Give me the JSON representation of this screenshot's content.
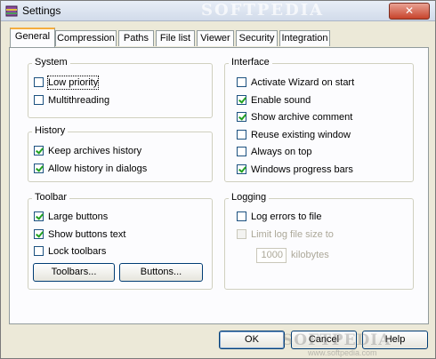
{
  "window": {
    "title": "Settings",
    "watermark": "SOFTPEDIA",
    "close_glyph": "✕"
  },
  "tabs": [
    {
      "label": "General",
      "active": true
    },
    {
      "label": "Compression"
    },
    {
      "label": "Paths"
    },
    {
      "label": "File list"
    },
    {
      "label": "Viewer"
    },
    {
      "label": "Security"
    },
    {
      "label": "Integration"
    }
  ],
  "groups": {
    "system": {
      "title": "System",
      "items": [
        {
          "label": "Low priority",
          "checked": false
        },
        {
          "label": "Multithreading",
          "checked": false
        }
      ]
    },
    "history": {
      "title": "History",
      "items": [
        {
          "label": "Keep archives history",
          "checked": true
        },
        {
          "label": "Allow history in dialogs",
          "checked": true
        }
      ]
    },
    "toolbar": {
      "title": "Toolbar",
      "items": [
        {
          "label": "Large buttons",
          "checked": true
        },
        {
          "label": "Show buttons text",
          "checked": true
        },
        {
          "label": "Lock toolbars",
          "checked": false
        }
      ],
      "buttons": [
        "Toolbars...",
        "Buttons..."
      ]
    },
    "interface": {
      "title": "Interface",
      "items": [
        {
          "label": "Activate Wizard on start",
          "checked": false
        },
        {
          "label": "Enable sound",
          "checked": true
        },
        {
          "label": "Show archive comment",
          "checked": true
        },
        {
          "label": "Reuse existing window",
          "checked": false
        },
        {
          "label": "Always on top",
          "checked": false
        },
        {
          "label": "Windows progress bars",
          "checked": true
        }
      ]
    },
    "logging": {
      "title": "Logging",
      "items": [
        {
          "label": "Log errors to file",
          "checked": false
        },
        {
          "label": "Limit log file size to",
          "checked": false,
          "disabled": true
        }
      ],
      "size_value": "1000",
      "size_unit": "kilobytes"
    }
  },
  "footer": {
    "ok": "OK",
    "cancel": "Cancel",
    "help": "Help",
    "watermark": "SOFTPEDIA",
    "watermark_url": "www.softpedia.com"
  }
}
